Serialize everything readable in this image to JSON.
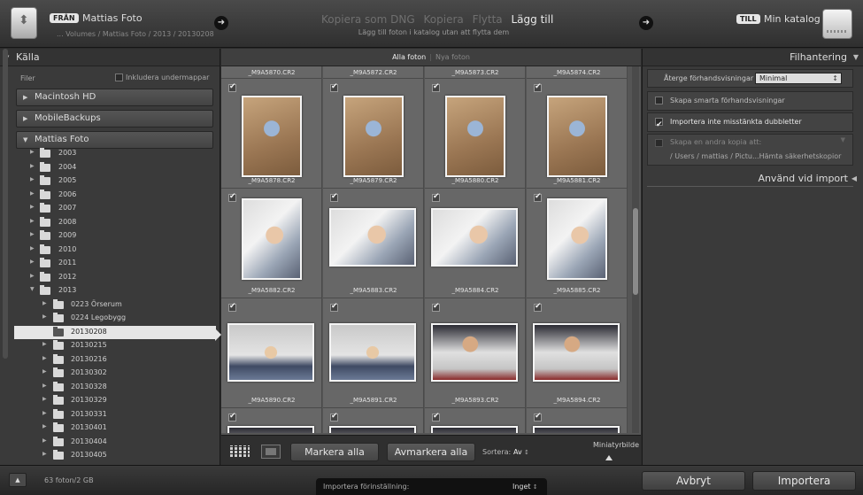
{
  "header": {
    "from_badge": "FRÅN",
    "from_source": "Mattias Foto",
    "from_path": "... Volumes / Mattias Foto / 2013 / 20130208",
    "modes": [
      "Kopiera som DNG",
      "Kopiera",
      "Flytta",
      "Lägg till"
    ],
    "active_mode": "Lägg till",
    "mode_subtitle": "Lägg till foton i katalog utan att flytta dem",
    "to_badge": "TILL",
    "to_destination": "Min katalog"
  },
  "source_panel": {
    "title": "Källa",
    "files_label": "Filer",
    "include_subfolders": "Inkludera undermappar",
    "include_subfolders_checked": false,
    "volumes": [
      "Macintosh HD",
      "MobileBackups",
      "Mattias Foto"
    ],
    "folders": [
      {
        "name": "2003",
        "level": 0
      },
      {
        "name": "2004",
        "level": 0
      },
      {
        "name": "2005",
        "level": 0
      },
      {
        "name": "2006",
        "level": 0
      },
      {
        "name": "2007",
        "level": 0
      },
      {
        "name": "2008",
        "level": 0
      },
      {
        "name": "2009",
        "level": 0
      },
      {
        "name": "2010",
        "level": 0
      },
      {
        "name": "2011",
        "level": 0
      },
      {
        "name": "2012",
        "level": 0
      },
      {
        "name": "2013",
        "level": 0,
        "expanded": true
      },
      {
        "name": "0223 Örserum",
        "level": 1
      },
      {
        "name": "0224 Legobygg",
        "level": 1
      },
      {
        "name": "20130208",
        "level": 1,
        "selected": true
      },
      {
        "name": "20130215",
        "level": 1
      },
      {
        "name": "20130216",
        "level": 1
      },
      {
        "name": "20130302",
        "level": 1
      },
      {
        "name": "20130328",
        "level": 1
      },
      {
        "name": "20130329",
        "level": 1
      },
      {
        "name": "20130331",
        "level": 1
      },
      {
        "name": "20130401",
        "level": 1
      },
      {
        "name": "20130404",
        "level": 1
      },
      {
        "name": "20130405",
        "level": 1
      }
    ]
  },
  "view_tabs": {
    "all": "Alla foton",
    "new": "Nya foton"
  },
  "grid": {
    "top_partial": [
      "_M9A5870.CR2",
      "_M9A5872.CR2",
      "_M9A5873.CR2",
      "_M9A5874.CR2"
    ],
    "rows": [
      [
        {
          "file": "_M9A5878.CR2",
          "orient": "portrait",
          "scene": "floor"
        },
        {
          "file": "_M9A5879.CR2",
          "orient": "portrait",
          "scene": "floor"
        },
        {
          "file": "_M9A5880.CR2",
          "orient": "portrait",
          "scene": "floor"
        },
        {
          "file": "_M9A5881.CR2",
          "orient": "portrait",
          "scene": "floor"
        }
      ],
      [
        {
          "file": "_M9A5882.CR2",
          "orient": "portrait",
          "scene": "bed"
        },
        {
          "file": "_M9A5883.CR2",
          "orient": "land",
          "scene": "bed"
        },
        {
          "file": "_M9A5884.CR2",
          "orient": "land",
          "scene": "bed"
        },
        {
          "file": "_M9A5885.CR2",
          "orient": "portrait",
          "scene": "bed"
        }
      ],
      [
        {
          "file": "_M9A5890.CR2",
          "orient": "land",
          "scene": "sofa"
        },
        {
          "file": "_M9A5891.CR2",
          "orient": "land",
          "scene": "sofa"
        },
        {
          "file": "_M9A5893.CR2",
          "orient": "land",
          "scene": "man"
        },
        {
          "file": "_M9A5894.CR2",
          "orient": "land",
          "scene": "man"
        }
      ]
    ],
    "bottom_partial_count": 4
  },
  "toolbar": {
    "mark_all": "Markera alla",
    "unmark_all": "Avmarkera alla",
    "sort_label": "Sortera:",
    "sort_value": "Av",
    "thumbnail_label": "Miniatyrbilde"
  },
  "file_handling": {
    "title": "Filhantering",
    "preview_label": "Återge förhandsvisningar",
    "preview_value": "Minimal",
    "smart_previews": "Skapa smarta förhandsvisningar",
    "smart_previews_checked": false,
    "no_duplicates": "Importera inte misstänkta dubbletter",
    "no_duplicates_checked": true,
    "second_copy": "Skapa en andra kopia att:",
    "second_copy_checked": false,
    "second_copy_path": "/ Users / mattias / Pictu...Hämta säkerhetskopior"
  },
  "apply_during_import": {
    "title": "Använd vid import"
  },
  "bottom": {
    "photo_count": "63 foton/2 GB",
    "preset_label": "Importera förinställning:",
    "preset_value": "Inget",
    "cancel": "Avbryt",
    "import": "Importera"
  }
}
